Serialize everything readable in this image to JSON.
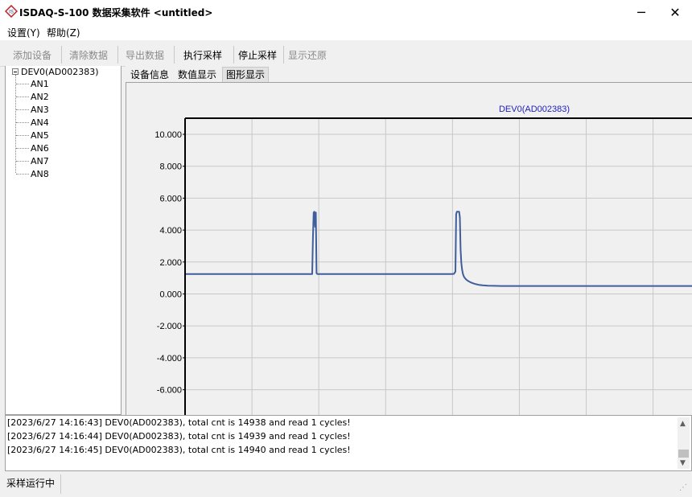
{
  "window": {
    "title": "ISDAQ-S-100 数据采集软件 <untitled>",
    "minimize_glyph": "─",
    "close_glyph": "✕"
  },
  "menu": {
    "items": [
      {
        "label": "设置(Y)"
      },
      {
        "label": "帮助(Z)"
      }
    ]
  },
  "toolbar": {
    "buttons": [
      {
        "label": "添加设备",
        "enabled": false
      },
      {
        "label": "清除数据",
        "enabled": false
      },
      {
        "label": "导出数据",
        "enabled": false
      },
      {
        "label": "执行采样",
        "enabled": true
      },
      {
        "label": "停止采样",
        "enabled": true
      },
      {
        "label": "显示还原",
        "enabled": false
      }
    ]
  },
  "tree": {
    "root": {
      "label": "DEV0(AD002383)",
      "expanded": true
    },
    "children": [
      "AN1",
      "AN2",
      "AN3",
      "AN4",
      "AN5",
      "AN6",
      "AN7",
      "AN8"
    ]
  },
  "tabs": [
    {
      "label": "设备信息",
      "active": false
    },
    {
      "label": "数值显示",
      "active": false
    },
    {
      "label": "图形显示",
      "active": true
    }
  ],
  "chart_data": {
    "type": "line",
    "title": "DEV0(AD002383)",
    "ytick_labels": [
      "10.000",
      "8.000",
      "6.000",
      "4.000",
      "2.000",
      "0.000",
      "-2.000",
      "-4.000",
      "-6.000"
    ],
    "yticks": [
      10,
      8,
      6,
      4,
      2,
      0,
      -2,
      -4,
      -6
    ],
    "ylim": [
      -7.6,
      11
    ],
    "xlim": [
      0,
      690
    ],
    "x_gridlines": [
      0,
      91,
      182,
      273,
      364,
      455,
      546,
      637
    ],
    "grid": true,
    "line_color": "#3f5e9c",
    "series": [
      {
        "x": [
          0,
          173,
          174,
          175,
          176,
          177,
          178,
          179,
          180,
          363,
          366,
          368,
          369,
          370,
          373,
          374,
          375,
          376,
          377,
          378,
          379,
          380,
          382,
          384,
          386,
          388,
          390,
          393,
          396,
          400,
          405,
          412,
          420,
          430,
          690
        ],
        "y": [
          1.25,
          1.25,
          3.5,
          5.1,
          5.15,
          4.2,
          5.1,
          1.3,
          1.25,
          1.25,
          1.26,
          1.4,
          5.0,
          5.15,
          5.15,
          4.8,
          2.8,
          1.95,
          1.55,
          1.3,
          1.15,
          1.05,
          0.93,
          0.85,
          0.79,
          0.74,
          0.7,
          0.65,
          0.61,
          0.57,
          0.54,
          0.52,
          0.51,
          0.5,
          0.5
        ]
      }
    ]
  },
  "log": {
    "lines": [
      "[2023/6/27 14:16:43] DEV0(AD002383), total cnt is 14938 and read 1 cycles!",
      "[2023/6/27 14:16:44] DEV0(AD002383), total cnt is 14939 and read 1 cycles!",
      "[2023/6/27 14:16:45] DEV0(AD002383), total cnt is 14940 and read 1 cycles!"
    ]
  },
  "status": {
    "text": "采样运行中"
  }
}
